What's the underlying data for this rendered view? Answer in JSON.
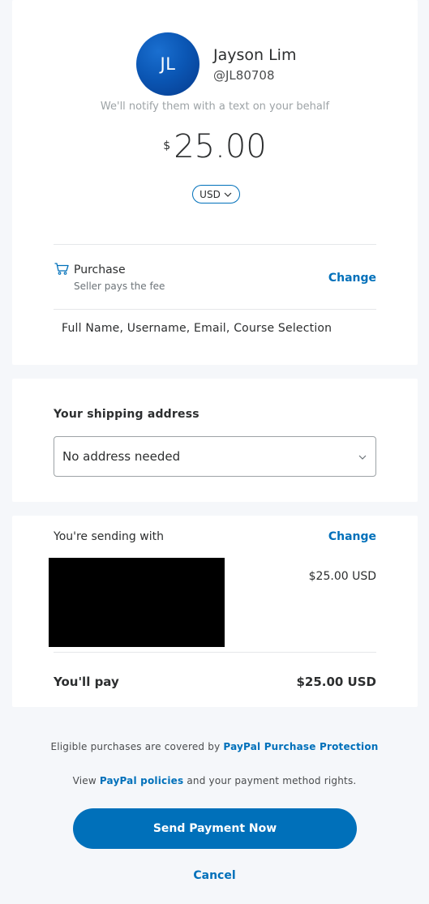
{
  "recipient": {
    "initials": "JL",
    "name": "Jayson Lim",
    "handle": "@JL80708",
    "notify_text": "We'll notify them with a text on your behalf"
  },
  "payment": {
    "currency_symbol": "$",
    "amount": "25.00",
    "currency": "USD"
  },
  "purchase": {
    "type_label": "Purchase",
    "fee_text": "Seller pays the fee",
    "change_label": "Change",
    "note": "Full Name, Username, Email, Course Selection"
  },
  "shipping": {
    "label": "Your shipping address",
    "selected": "No address needed"
  },
  "funding": {
    "label": "You're sending with",
    "change_label": "Change",
    "amount": "$25.00 USD",
    "total_label": "You'll pay",
    "total_amount": "$25.00 USD"
  },
  "footer": {
    "protection_prefix": "Eligible purchases are covered by ",
    "protection_link": "PayPal Purchase Protection",
    "policies_prefix": "View ",
    "policies_link": "PayPal policies",
    "policies_suffix": " and your payment method rights."
  },
  "actions": {
    "send_label": "Send Payment Now",
    "cancel_label": "Cancel"
  },
  "colors": {
    "accent": "#0070ba",
    "background": "#f5f7fa",
    "card": "#ffffff"
  },
  "icons": [
    "cart-icon",
    "chevron-down-icon"
  ]
}
